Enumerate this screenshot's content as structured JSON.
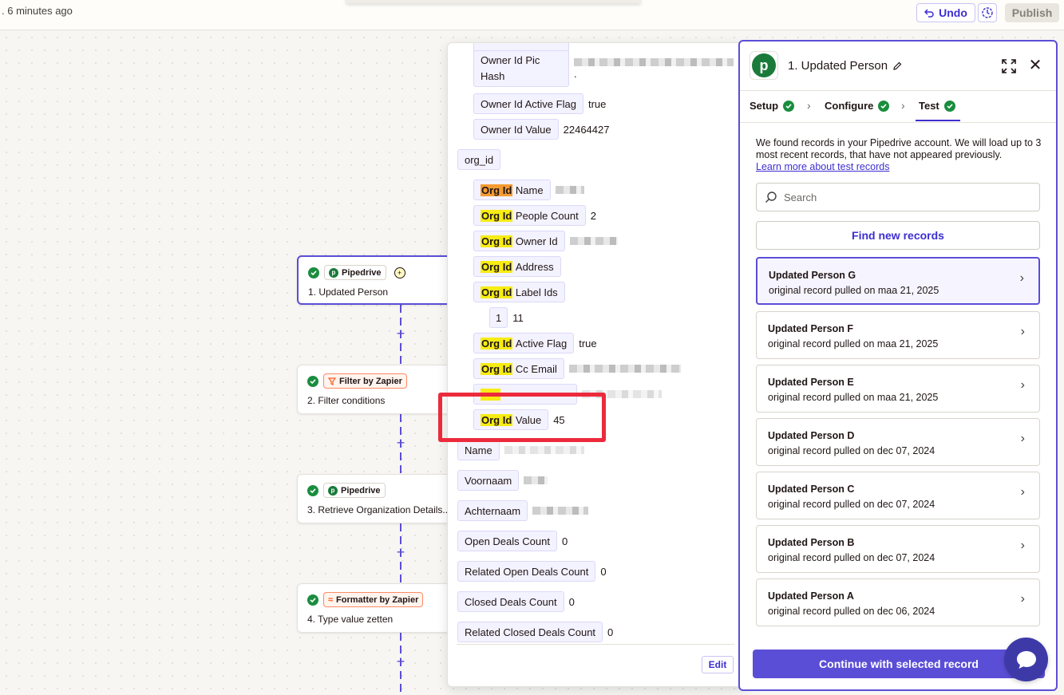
{
  "topbar": {
    "saved_text": ". 6 minutes ago",
    "undo_label": "Undo",
    "publish_label": "Publish"
  },
  "steps": [
    {
      "app": "Pipedrive",
      "title": "1. Updated Person"
    },
    {
      "app": "Filter by Zapier",
      "title": "2. Filter conditions"
    },
    {
      "app": "Pipedrive",
      "title": "3. Retrieve Organization Details..."
    },
    {
      "app": "Formatter by Zapier",
      "title": "4. Type value zetten"
    }
  ],
  "data_popover": {
    "fields": {
      "owner_pic_hash": "Owner Id Pic Hash",
      "owner_pic_hash_suffix": ".",
      "owner_active_flag": "Owner Id Active Flag",
      "owner_active_flag_value": "true",
      "owner_value": "Owner Id Value",
      "owner_value_value": "22464427",
      "org_id_group": "org_id",
      "org_prefix": "Org Id",
      "org_name": "Name",
      "org_people_count": "People Count",
      "org_people_count_value": "2",
      "org_owner_id": "Owner Id",
      "org_address": "Address",
      "org_label_ids": "Label Ids",
      "label_index": "1",
      "label_value": "11",
      "org_active_flag": "Active Flag",
      "org_active_flag_value": "true",
      "org_cc_email": "Cc Email",
      "org_value": "Value",
      "org_value_value": "45",
      "name": "Name",
      "voornaam": "Voornaam",
      "achternaam": "Achternaam",
      "open_deals_count": "Open Deals Count",
      "open_deals_count_value": "0",
      "related_open_deals_count": "Related Open Deals Count",
      "related_open_deals_count_value": "0",
      "closed_deals_count": "Closed Deals Count",
      "closed_deals_count_value": "0",
      "related_closed_deals_count": "Related Closed Deals Count",
      "related_closed_deals_count_value": "0"
    },
    "edit_label": "Edit"
  },
  "panel": {
    "title": "1. Updated Person",
    "tabs": [
      {
        "label": "Setup"
      },
      {
        "label": "Configure"
      },
      {
        "label": "Test"
      }
    ],
    "info_text": "We found records in your Pipedrive account. We will load up to 3 most recent records, that have not appeared previously.",
    "learn_link": "Learn more about test records",
    "search_placeholder": "Search",
    "find_button": "Find new records",
    "records": [
      {
        "title": "Updated Person G",
        "subtitle": "original record pulled on maa 21, 2025"
      },
      {
        "title": "Updated Person F",
        "subtitle": "original record pulled on maa 21, 2025"
      },
      {
        "title": "Updated Person E",
        "subtitle": "original record pulled on maa 21, 2025"
      },
      {
        "title": "Updated Person D",
        "subtitle": "original record pulled on dec 07, 2024"
      },
      {
        "title": "Updated Person C",
        "subtitle": "original record pulled on dec 07, 2024"
      },
      {
        "title": "Updated Person B",
        "subtitle": "original record pulled on dec 07, 2024"
      },
      {
        "title": "Updated Person A",
        "subtitle": "original record pulled on dec 06, 2024"
      }
    ],
    "continue_button": "Continue with selected record"
  },
  "colors": {
    "accent": "#5b4ed6",
    "link": "#3d2fd1",
    "success": "#1a8d3e",
    "highlight": "#f7ec13",
    "annotation": "#ec2a3c"
  }
}
